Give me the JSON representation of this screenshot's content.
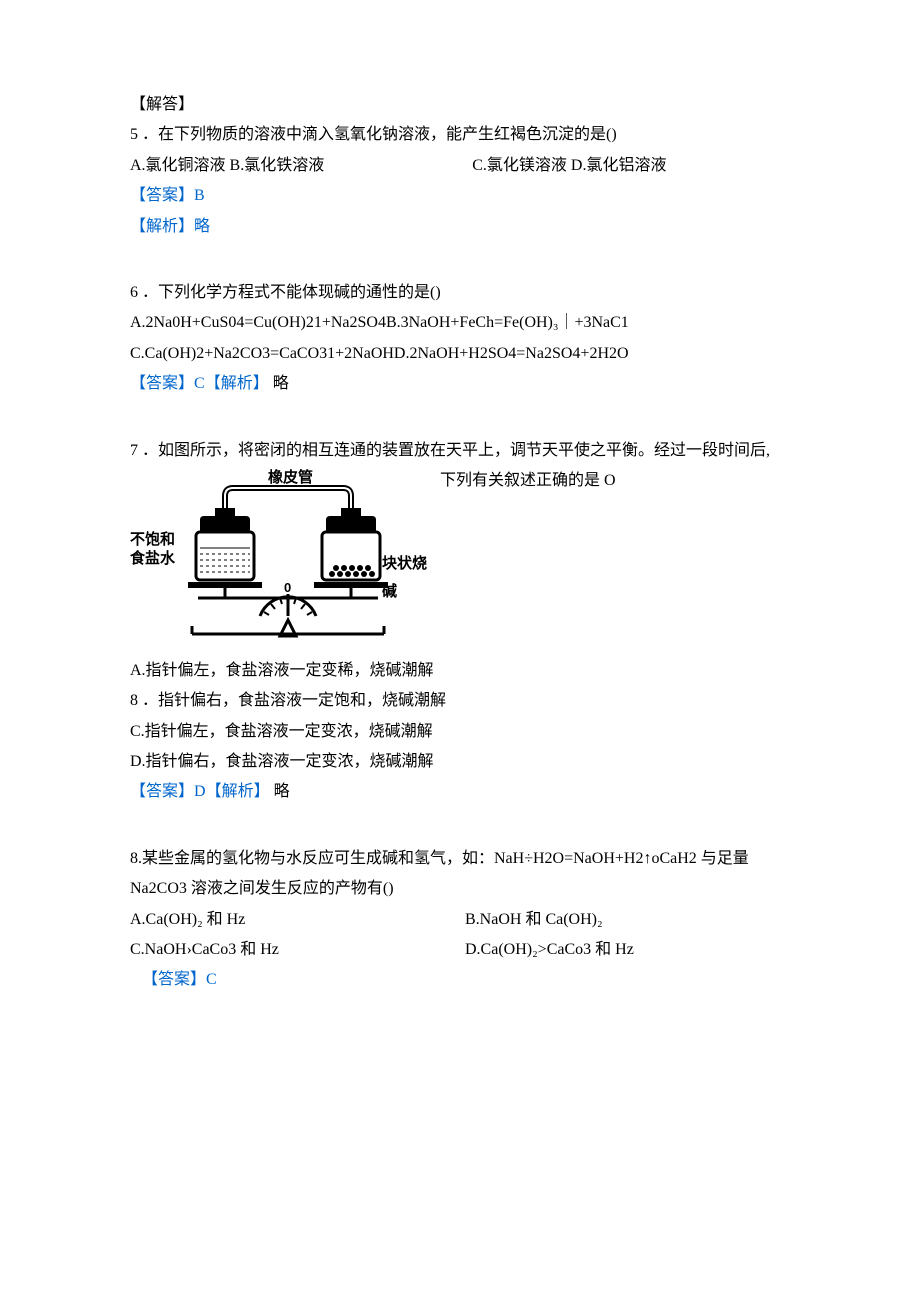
{
  "section_header": "【解答】",
  "q5": {
    "num": "5",
    "stem": "．在下列物质的溶液中滴入氢氧化钠溶液，能产生红褐色沉淀的是()",
    "optA": "A.氯化铜溶液 B.氯化铁溶液",
    "optC": "C.氯化镁溶液 D.氯化铝溶液",
    "ans_label": "【答案】",
    "ans_val": "B",
    "exp_label": "【解析】",
    "exp_val": "略"
  },
  "q6": {
    "num": "6",
    "stem": "．下列化学方程式不能体现碱的通性的是()",
    "line1": "A.2Na0H+CuS04=Cu(OH)21+Na2SO4B.3NaOH+FeCh=Fe(OH)₃｜+3NaC1",
    "line2": "C.Ca(OH)2+Na2CO3=CaCO31+2NaOHD.2NaOH+H2SO4=Na2SO4+2H2O",
    "ans_label": "【答案】",
    "ans_val": "C",
    "exp_label": "【解析】",
    "exp_val": "略"
  },
  "q7": {
    "num": "7",
    "stem": "．如图所示，将密闭的相互连通的装置放在天平上，调节天平使之平衡。经过一段时间后,",
    "side": "下列有关叙述正确的是 O",
    "fig": {
      "tube": "橡皮管",
      "left1": "不饱和",
      "left2": "食盐水",
      "right": "块状烧碱",
      "zero": "0"
    },
    "optA": "A.指针偏左，食盐溶液一定变稀，烧碱潮解",
    "optB_num": "8",
    "optB": "．指针偏右，食盐溶液一定饱和，烧碱潮解",
    "optC": "C.指针偏左，食盐溶液一定变浓，烧碱潮解",
    "optD": "D.指针偏右，食盐溶液一定变浓，烧碱潮解",
    "ans_label": "【答案】",
    "ans_val": "D",
    "exp_label": "【解析】",
    "exp_val": "略"
  },
  "q8": {
    "stem1": "8.某些金属的氢化物与水反应可生成碱和氢气，如：NaH÷H2O=NaOH+H2↑oCaH2 与足量",
    "stem2": "Na2CO3 溶液之间发生反应的产物有()",
    "optA": "A.Ca(OH)₂ 和 Hz",
    "optB": "B.NaOH 和 Ca(OH)₂",
    "optC": "C.NaOH›CaCo3 和 Hz",
    "optD": "D.Ca(OH)₂>CaCo3 和 Hz",
    "ans_label": "【答案】",
    "ans_val": "C"
  }
}
